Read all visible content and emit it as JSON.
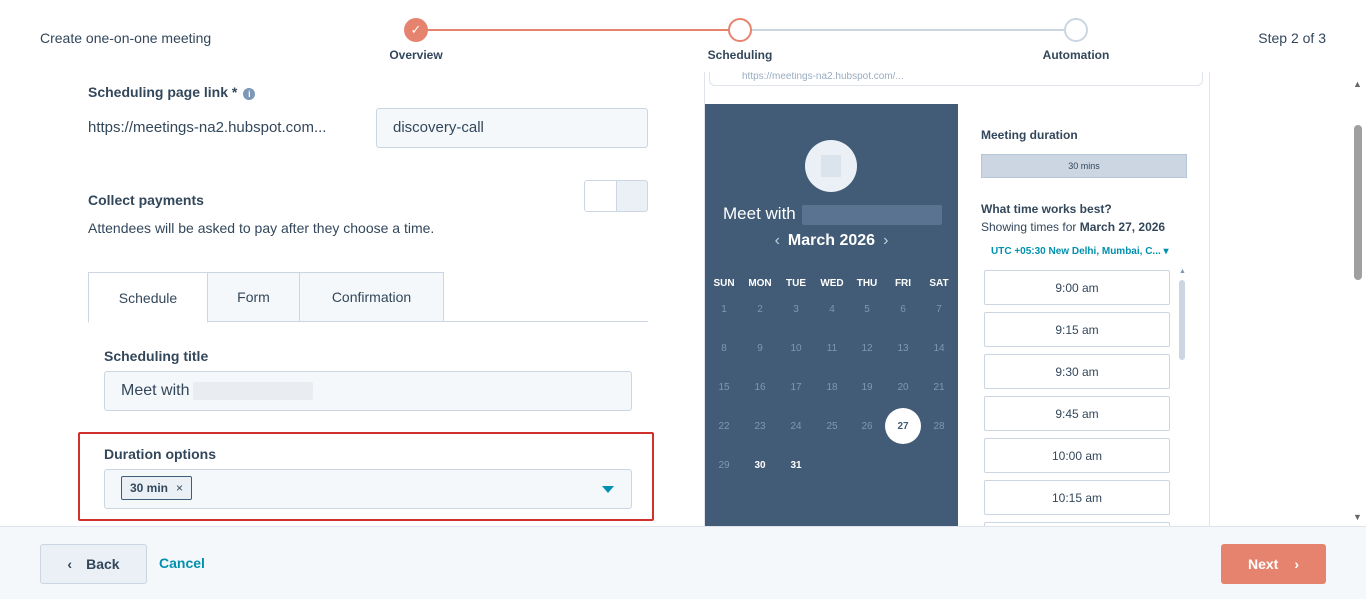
{
  "header": {
    "title": "Create one-on-one meeting",
    "step_indicator": "Step 2 of 3",
    "steps": [
      {
        "label": "Overview",
        "state": "completed"
      },
      {
        "label": "Scheduling",
        "state": "current"
      },
      {
        "label": "Automation",
        "state": "upcoming"
      }
    ]
  },
  "form": {
    "scheduling_link": {
      "label": "Scheduling page link *",
      "base_url": "https://meetings-na2.hubspot.com...",
      "slug_value": "discovery-call"
    },
    "payments": {
      "label": "Collect payments",
      "description": "Attendees will be asked to pay after they choose a time.",
      "enabled": false
    },
    "tabs": [
      {
        "label": "Schedule",
        "active": true
      },
      {
        "label": "Form",
        "active": false
      },
      {
        "label": "Confirmation",
        "active": false
      }
    ],
    "scheduling_title": {
      "label": "Scheduling title",
      "value": "Meet with"
    },
    "duration_options": {
      "label": "Duration options",
      "selected_chip": "30 min",
      "chip_remove": "×"
    }
  },
  "preview": {
    "url_text": "https://meetings-na2.hubspot.com/...",
    "meet_with": "Meet with",
    "month_label": "March 2026",
    "prev_arrow": "‹",
    "next_arrow": "›",
    "weekdays": [
      "SUN",
      "MON",
      "TUE",
      "WED",
      "THU",
      "FRI",
      "SAT"
    ],
    "weeks": [
      [
        1,
        2,
        3,
        4,
        5,
        6,
        7
      ],
      [
        8,
        9,
        10,
        11,
        12,
        13,
        14
      ],
      [
        15,
        16,
        17,
        18,
        19,
        20,
        21
      ],
      [
        22,
        23,
        24,
        25,
        26,
        27,
        28
      ],
      [
        29,
        30,
        31
      ]
    ],
    "selected_day": 27,
    "available_days": [
      27,
      30,
      31
    ],
    "meeting_duration_label": "Meeting duration",
    "duration_bar": "30 mins",
    "time_question": "What time works best?",
    "showing_prefix": "Showing times for ",
    "showing_date": "March 27, 2026",
    "timezone": "UTC +05:30 New Delhi, Mumbai, C...",
    "time_slots": [
      "9:00 am",
      "9:15 am",
      "9:30 am",
      "9:45 am",
      "10:00 am",
      "10:15 am"
    ]
  },
  "footer": {
    "back_label": "Back",
    "cancel_label": "Cancel",
    "next_label": "Next"
  },
  "colors": {
    "accent": "#e5836e",
    "link": "#0091ae",
    "calendar_bg": "#425b76",
    "highlight_border": "#d0312d"
  }
}
